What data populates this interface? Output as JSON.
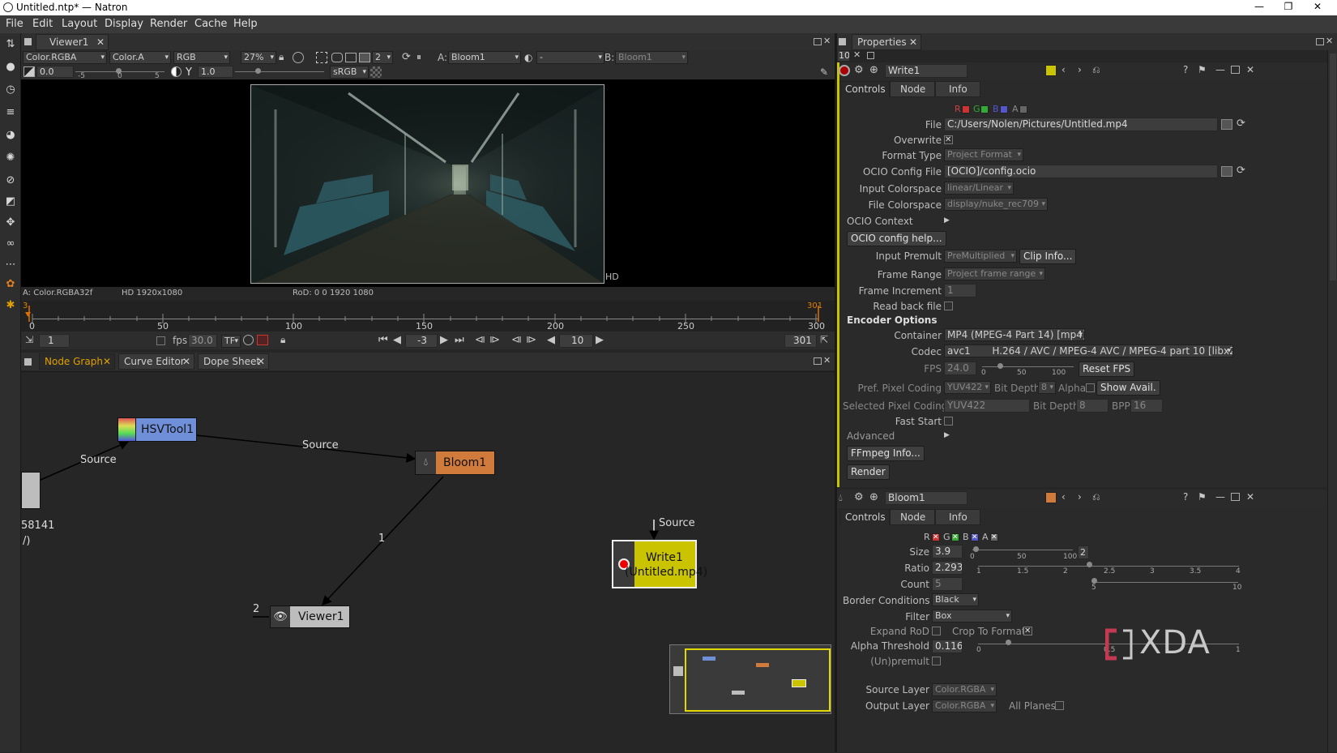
{
  "window": {
    "title": "Untitled.ntp* — Natron",
    "min": "—",
    "max": "❐",
    "close": "✕"
  },
  "menu": [
    "File",
    "Edit",
    "Layout",
    "Display",
    "Render",
    "Cache",
    "Help"
  ],
  "viewer": {
    "tab": "Viewer1",
    "layer": "Color.RGBA",
    "alpha": "Color.A",
    "channels": "RGB",
    "zoom": "27%",
    "proxy": "2",
    "input_a_label": "A:",
    "input_a": "Bloom1",
    "input_b_label": "B:",
    "input_b": "Bloom1",
    "input_b_blank": "-",
    "gain": "0.0",
    "gamma_label": "Y",
    "gamma": "1.0",
    "colorspace": "sRGB",
    "ticks_gain": [
      "-5",
      "0",
      "5"
    ],
    "info_left": "A: Color.RGBA32f",
    "info_format": "HD 1920x1080",
    "info_rod": "RoD: 0 0 1920 1080",
    "format_badge": "HD"
  },
  "timeline": {
    "start_marker": "3",
    "end_marker": "301",
    "ticks": [
      "0",
      "50",
      "100",
      "150",
      "200",
      "250",
      "300"
    ],
    "current_frame": "1",
    "fps_label": "fps:",
    "fps": "30.0",
    "tf": "TF",
    "step_back": "-3",
    "step": "10",
    "end": "301"
  },
  "graph": {
    "tabs": [
      "Node Graph",
      "Curve Editor",
      "Dope Sheet"
    ],
    "nodes": {
      "hsv": "HSVTool1",
      "bloom": "Bloom1",
      "write": "Write1",
      "write_file": "(Untitled.mp4)",
      "viewer": "Viewer1",
      "partial": "58141",
      "partial2": "/)"
    },
    "edges": {
      "src1": "Source",
      "src2": "Source",
      "src3": "Source",
      "input1": "1",
      "input2": "2"
    }
  },
  "properties": {
    "tab": "Properties",
    "max_nodes": "10",
    "write": {
      "name": "Write1",
      "tabs": [
        "Controls",
        "Node",
        "Info"
      ],
      "channels": [
        "R",
        "G",
        "B",
        "A"
      ],
      "file_label": "File",
      "file": "C:/Users/Nolen/Pictures/Untitled.mp4",
      "overwrite": "Overwrite",
      "format_type_label": "Format Type",
      "format_type": "Project Format",
      "ocio_file_label": "OCIO Config File",
      "ocio_file": "[OCIO]/config.ocio",
      "input_cs_label": "Input Colorspace",
      "input_cs": "linear/Linear",
      "file_cs_label": "File Colorspace",
      "file_cs": "display/nuke_rec709",
      "ocio_context": "OCIO Context",
      "ocio_help": "OCIO config help...",
      "input_premult_label": "Input Premult",
      "input_premult": "PreMultiplied",
      "clip_info": "Clip Info...",
      "frame_range_label": "Frame Range",
      "frame_range": "Project frame range",
      "frame_inc_label": "Frame Increment",
      "frame_inc": "1",
      "read_back": "Read back file",
      "encoder": "Encoder Options",
      "container_label": "Container",
      "container": "MP4 (MPEG-4 Part 14) [mp4]",
      "codec_label": "Codec",
      "codec": "avc1       H.264 / AVC / MPEG-4 AVC / MPEG-4 part 10 [libx264]",
      "fps_label": "FPS",
      "fps": "24.0",
      "fps_ticks": [
        "0",
        "50",
        "100"
      ],
      "reset_fps": "Reset FPS",
      "pix_label": "Pref. Pixel Coding",
      "pix": "YUV422",
      "bit_label": "Bit Depth",
      "bit": "8",
      "alpha_label": "Alpha",
      "show_avail": "Show Avail.",
      "sel_pix_label": "Selected Pixel Coding",
      "sel_pix": "YUV422",
      "sel_bit_label": "Bit Depth",
      "sel_bit": "8",
      "bpp_label": "BPP",
      "bpp": "16",
      "fast_start": "Fast Start",
      "advanced": "Advanced",
      "ffmpeg_info": "FFmpeg Info...",
      "render": "Render"
    },
    "bloom": {
      "name": "Bloom1",
      "tabs": [
        "Controls",
        "Node",
        "Info"
      ],
      "channels": [
        "R",
        "G",
        "B",
        "A"
      ],
      "size_label": "Size",
      "size": "3.9",
      "size_ticks": [
        "0",
        "50",
        "100"
      ],
      "size_dim": "2",
      "ratio_label": "Ratio",
      "ratio": "2.293",
      "ratio_ticks": [
        "1",
        "1.5",
        "2",
        "2.5",
        "3",
        "3.5",
        "4"
      ],
      "count_label": "Count",
      "count": "5",
      "count_ticks": [
        "5",
        "10"
      ],
      "border_label": "Border Conditions",
      "border": "Black",
      "filter_label": "Filter",
      "filter": "Box",
      "expand_rod": "Expand RoD",
      "crop": "Crop To Format",
      "alpha_thr_label": "Alpha Threshold",
      "alpha_thr": "0.116",
      "alpha_ticks": [
        "0",
        "0.5",
        "1"
      ],
      "unpremult": "(Un)premult",
      "src_layer_label": "Source Layer",
      "src_layer": "Color.RGBA",
      "out_layer_label": "Output Layer",
      "out_layer": "Color.RGBA",
      "all_planes": "All Planes"
    }
  },
  "watermark": "XDA",
  "colors": {
    "write_node": "#c9c300",
    "bloom_node": "#d07a3c",
    "hsv_node": "#6f8fd8",
    "viewer_node": "#bdbdbd",
    "accent": "#e0a000"
  }
}
